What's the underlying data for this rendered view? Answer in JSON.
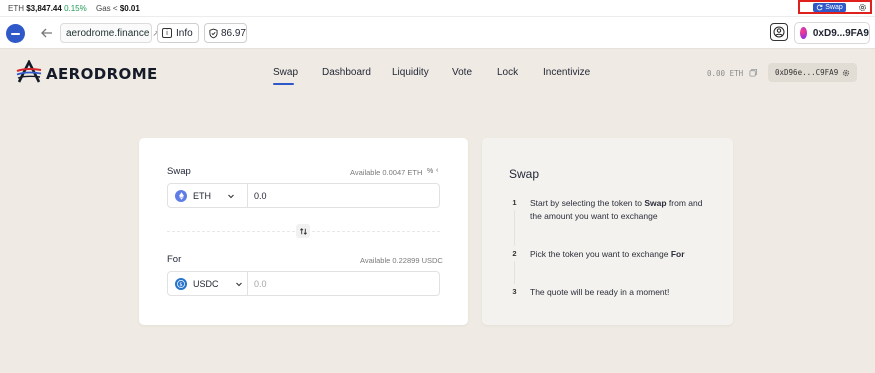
{
  "statusbar": {
    "eth_label": "ETH",
    "eth_price": "$3,847.44",
    "eth_change": "0.15%",
    "gas_label": "Gas <",
    "gas_value": "$0.01",
    "swap_button": "Swap"
  },
  "toolbar": {
    "url": "aerodrome.finance",
    "info_label": "Info",
    "score": "86.97",
    "account": "0xD9...9FA9"
  },
  "header": {
    "logo_text": "AERODROME",
    "nav": [
      {
        "label": "Swap",
        "active": true
      },
      {
        "label": "Dashboard",
        "active": false
      },
      {
        "label": "Liquidity",
        "active": false
      },
      {
        "label": "Vote",
        "active": false
      },
      {
        "label": "Lock",
        "active": false
      },
      {
        "label": "Incentivize",
        "active": false
      }
    ],
    "balance": "0.00 ETH",
    "address": "0xD96e...C9FA9"
  },
  "swap_card": {
    "from_label": "Swap",
    "from_available": "Available 0.0047 ETH",
    "from_pct": "%",
    "from_token": "ETH",
    "from_amount": "0.0",
    "to_label": "For",
    "to_available": "Available 0.22899 USDC",
    "to_token": "USDC",
    "to_amount_placeholder": "0.0"
  },
  "info_card": {
    "title": "Swap",
    "steps": [
      {
        "num": "1",
        "text_before": "Start by selecting the token to ",
        "bold": "Swap",
        "text_after": " from and the amount you want to exchange"
      },
      {
        "num": "2",
        "text_before": "Pick the token you want to exchange ",
        "bold": "For",
        "text_after": ""
      },
      {
        "num": "3",
        "text_before": "The quote will be ready in a moment!",
        "bold": "",
        "text_after": ""
      }
    ]
  },
  "colors": {
    "accent": "#2f59c9",
    "background": "#efebe4",
    "highlight": "#e0201d"
  }
}
